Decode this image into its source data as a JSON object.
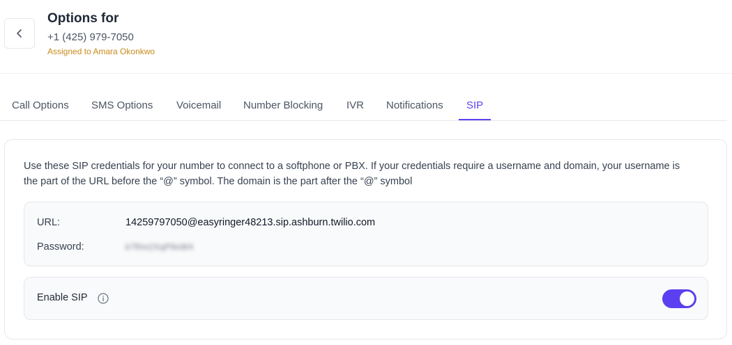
{
  "header": {
    "title": "Options for",
    "phone": "+1 (425) 979-7050",
    "assigned": "Assigned to Amara Okonkwo"
  },
  "tabs": [
    {
      "label": "Call Options"
    },
    {
      "label": "SMS Options"
    },
    {
      "label": "Voicemail"
    },
    {
      "label": "Number Blocking"
    },
    {
      "label": "IVR"
    },
    {
      "label": "Notifications"
    },
    {
      "label": "SIP",
      "active": true
    }
  ],
  "sip": {
    "description": "Use these SIP credentials for your number to connect to a softphone or PBX. If your credentials require a username and domain, your username is the part of the URL before the “@” symbol. The domain is the part after the “@” symbol",
    "url_label": "URL:",
    "url_value": "14259797050@easyringer48213.sip.ashburn.twilio.com",
    "password_label": "Password:",
    "password_value": "k7Rm2XqP9sW4",
    "enable_label": "Enable SIP",
    "enabled": true
  },
  "colors": {
    "accent": "#5b3ff0",
    "assigned": "#c98a1a"
  },
  "icons": {
    "back": "chevron-left-icon",
    "info": "info-icon"
  }
}
